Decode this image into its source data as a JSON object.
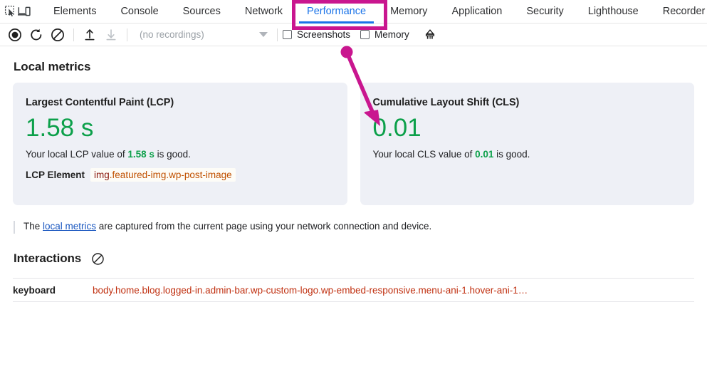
{
  "devtools": {
    "left_icons": [
      {
        "name": "inspect-element-icon",
        "title": "Inspect element"
      },
      {
        "name": "device-toolbar-icon",
        "title": "Toggle device toolbar"
      }
    ],
    "tabs": [
      {
        "label": "Elements",
        "active": false
      },
      {
        "label": "Console",
        "active": false
      },
      {
        "label": "Sources",
        "active": false
      },
      {
        "label": "Network",
        "active": false
      },
      {
        "label": "Performance",
        "active": true
      },
      {
        "label": "Memory",
        "active": false
      },
      {
        "label": "Application",
        "active": false
      },
      {
        "label": "Security",
        "active": false
      },
      {
        "label": "Lighthouse",
        "active": false
      },
      {
        "label": "Recorder",
        "active": false
      }
    ],
    "active_tab": "Performance",
    "accent_color": "#1a73e8",
    "annotation_color": "#c9168f"
  },
  "toolbar": {
    "buttons": [
      {
        "name": "record-button",
        "icon": "record-icon"
      },
      {
        "name": "record-and-reload-button",
        "icon": "reload-icon"
      },
      {
        "name": "clear-button",
        "icon": "clear-icon"
      },
      {
        "name": "load-profile-button",
        "icon": "upload-icon"
      },
      {
        "name": "save-profile-button",
        "icon": "download-icon",
        "disabled": true
      }
    ],
    "recordings_select": {
      "value": "(no recordings)",
      "placeholder": "(no recordings)"
    },
    "screenshots_checkbox": {
      "label": "Screenshots",
      "checked": false
    },
    "memory_checkbox": {
      "label": "Memory",
      "checked": false
    },
    "garbage_collect": {
      "name": "collect-garbage-icon",
      "label": ""
    }
  },
  "local_metrics": {
    "heading": "Local metrics",
    "cards": [
      {
        "title": "Largest Contentful Paint (LCP)",
        "value": "1.58 s",
        "value_color": "#0ca04a",
        "description_prefix": "Your local LCP value of ",
        "description_value": "1.58 s",
        "description_suffix": " is good.",
        "element_label": "LCP Element",
        "element_tag": "img",
        "element_classes": ".featured-img.wp-post-image"
      },
      {
        "title": "Cumulative Layout Shift (CLS)",
        "value": "0.01",
        "value_color": "#0ca04a",
        "description_prefix": "Your local CLS value of ",
        "description_value": "0.01",
        "description_suffix": " is good.",
        "element_label": "",
        "element_tag": "",
        "element_classes": ""
      }
    ],
    "info": {
      "prefix": "The ",
      "link": "local metrics",
      "suffix": " are captured from the current page using your network connection and device."
    }
  },
  "interactions": {
    "heading": "Interactions",
    "clear_icon": "clear-interactions-icon",
    "rows": [
      {
        "type": "keyboard",
        "selector": "body.home.blog.logged-in.admin-bar.wp-custom-logo.wp-embed-responsive.menu-ani-1.hover-ani-1…"
      }
    ]
  }
}
